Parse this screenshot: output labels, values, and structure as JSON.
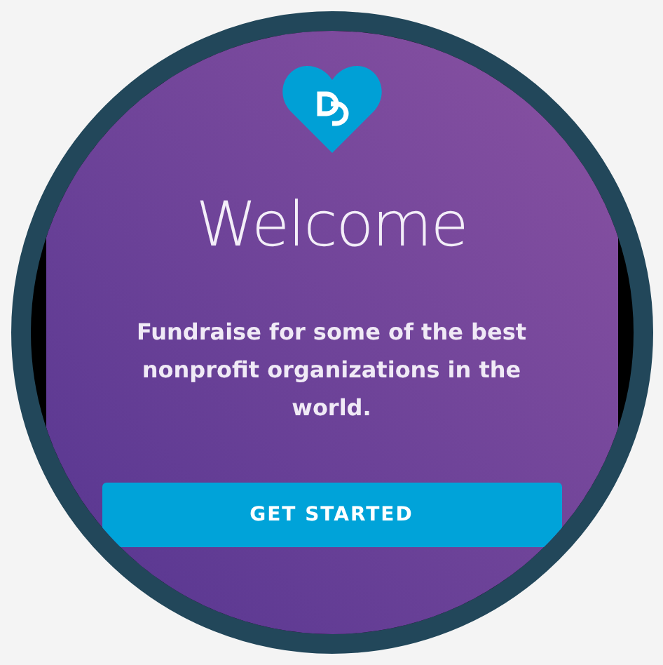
{
  "screen": {
    "title": "Welcome",
    "message": "Fundraise for some of the best nonprofit organizations in the world.",
    "button": {
      "label": "GET STARTED"
    }
  }
}
